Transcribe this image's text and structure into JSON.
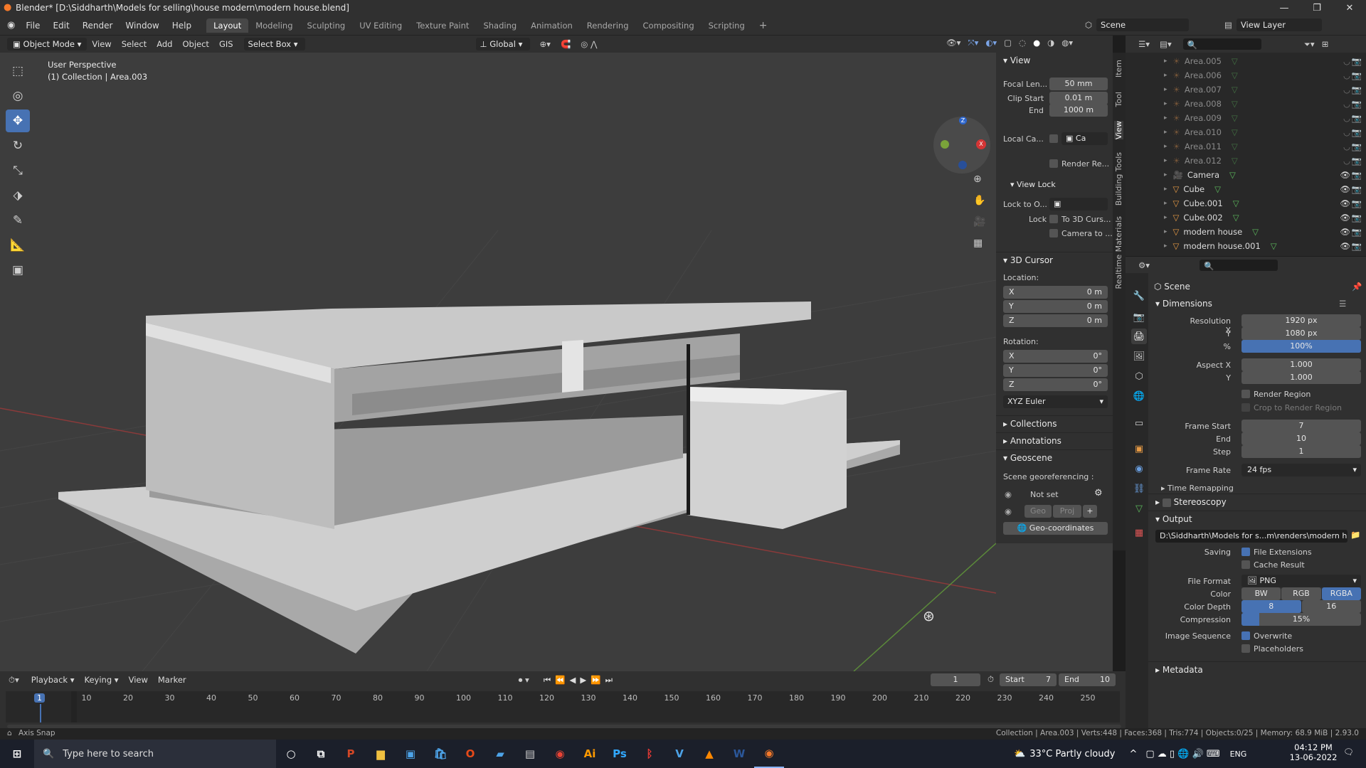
{
  "window": {
    "title": "Blender* [D:\\Siddharth\\Models for selling\\house modern\\modern house.blend]"
  },
  "menu": [
    "File",
    "Edit",
    "Render",
    "Window",
    "Help"
  ],
  "workspaces": [
    "Layout",
    "Modeling",
    "Sculpting",
    "UV Editing",
    "Texture Paint",
    "Shading",
    "Animation",
    "Rendering",
    "Compositing",
    "Scripting"
  ],
  "scene_name": "Scene",
  "view_layer": "View Layer",
  "viewport_header": {
    "mode": "Object Mode",
    "menus": [
      "View",
      "Select",
      "Add",
      "Object",
      "GIS"
    ],
    "select_box": "Select Box",
    "orientation": "Global"
  },
  "viewport": {
    "perspective": "User Perspective",
    "collection_info": "(1) Collection | Area.003"
  },
  "npanel": {
    "view_title": "View",
    "focal_label": "Focal Len...",
    "focal": "50 mm",
    "clip_start_label": "Clip Start",
    "clip_start": "0.01 m",
    "clip_end_label": "End",
    "clip_end": "1000 m",
    "local_camera_label": "Local Ca...",
    "local_camera_value": "Ca",
    "render_region": "Render Re...",
    "view_lock": "View Lock",
    "lock_to_label": "Lock to O...",
    "lock_label": "Lock",
    "to_3d_cursor": "To 3D Curs...",
    "camera_to": "Camera to ...",
    "cursor_title": "3D Cursor",
    "location_label": "Location:",
    "loc": [
      {
        "axis": "X",
        "value": "0 m"
      },
      {
        "axis": "Y",
        "value": "0 m"
      },
      {
        "axis": "Z",
        "value": "0 m"
      }
    ],
    "rotation_label": "Rotation:",
    "rot": [
      {
        "axis": "X",
        "value": "0°"
      },
      {
        "axis": "Y",
        "value": "0°"
      },
      {
        "axis": "Z",
        "value": "0°"
      }
    ],
    "rotation_mode": "XYZ Euler",
    "collections": "Collections",
    "annotations": "Annotations",
    "geoscene": "Geoscene",
    "georef": "Scene georeferencing :",
    "not_set": "Not set",
    "geo": "Geo",
    "proj": "Proj",
    "geo_coordinates": "Geo-coordinates"
  },
  "sidebar_tabs": [
    "Item",
    "Tool",
    "View",
    "Building Tools",
    "Realtime Materials"
  ],
  "outliner": [
    {
      "name": "Area.005",
      "type": "light",
      "dim": true
    },
    {
      "name": "Area.006",
      "type": "light",
      "dim": true
    },
    {
      "name": "Area.007",
      "type": "light",
      "dim": true
    },
    {
      "name": "Area.008",
      "type": "light",
      "dim": true
    },
    {
      "name": "Area.009",
      "type": "light",
      "dim": true
    },
    {
      "name": "Area.010",
      "type": "light",
      "dim": true
    },
    {
      "name": "Area.011",
      "type": "light",
      "dim": true
    },
    {
      "name": "Area.012",
      "type": "light",
      "dim": true
    },
    {
      "name": "Camera",
      "type": "camera",
      "dim": false
    },
    {
      "name": "Cube",
      "type": "mesh",
      "dim": false
    },
    {
      "name": "Cube.001",
      "type": "mesh",
      "dim": false
    },
    {
      "name": "Cube.002",
      "type": "mesh",
      "dim": false
    },
    {
      "name": "modern house",
      "type": "mesh",
      "dim": false
    },
    {
      "name": "modern house.001",
      "type": "mesh",
      "dim": false
    }
  ],
  "properties": {
    "context": "Scene",
    "dimensions": "Dimensions",
    "res_x_label": "Resolution X",
    "res_x": "1920 px",
    "res_y_label": "Y",
    "res_y": "1080 px",
    "pct_label": "%",
    "pct": "100%",
    "pct_fraction": 1.0,
    "aspect_x_label": "Aspect X",
    "aspect_x": "1.000",
    "aspect_y_label": "Y",
    "aspect_y": "1.000",
    "render_region": "Render Region",
    "crop": "Crop to Render Region",
    "frame_start_label": "Frame Start",
    "frame_start": "7",
    "end_label": "End",
    "frame_end": "10",
    "step_label": "Step",
    "step": "1",
    "frame_rate_label": "Frame Rate",
    "frame_rate": "24 fps",
    "time_remapping": "Time Remapping",
    "stereoscopy": "Stereoscopy",
    "output": "Output",
    "output_path": "D:\\Siddharth\\Models for s...m\\renders\\modern house",
    "saving_label": "Saving",
    "file_extensions": "File Extensions",
    "cache_result": "Cache Result",
    "file_format_label": "File Format",
    "file_format": "PNG",
    "color_label": "Color",
    "color_options": [
      "BW",
      "RGB",
      "RGBA"
    ],
    "color_selected": "RGBA",
    "depth_label": "Color Depth",
    "depth_options": [
      "8",
      "16"
    ],
    "depth_selected": "8",
    "compression_label": "Compression",
    "compression": "15%",
    "compression_fraction": 0.15,
    "image_sequence_label": "Image Sequence",
    "overwrite": "Overwrite",
    "placeholders": "Placeholders",
    "metadata": "Metadata"
  },
  "timeline": {
    "menus": [
      "Playback",
      "Keying",
      "View",
      "Marker"
    ],
    "current": "1",
    "start_label": "Start",
    "start": "7",
    "end_label": "End",
    "end": "10",
    "ticks": [
      "1",
      "10",
      "20",
      "30",
      "40",
      "50",
      "60",
      "70",
      "80",
      "90",
      "100",
      "110",
      "120",
      "130",
      "140",
      "150",
      "160",
      "170",
      "180",
      "190",
      "200",
      "210",
      "220",
      "230",
      "240",
      "250"
    ]
  },
  "status": {
    "left": "Axis Snap",
    "right": "Collection | Area.003 | Verts:448 | Faces:368 | Tris:774 | Objects:0/25 | Memory: 68.9 MiB | 2.93.0"
  },
  "taskbar": {
    "search": "Type here to search",
    "weather": "33°C  Partly cloudy",
    "lang": "ENG",
    "time": "04:12 PM",
    "date": "13-06-2022"
  },
  "colors": {
    "accent": "#4772b3",
    "bg": "#303030",
    "viewport": "#3d3d3d"
  }
}
